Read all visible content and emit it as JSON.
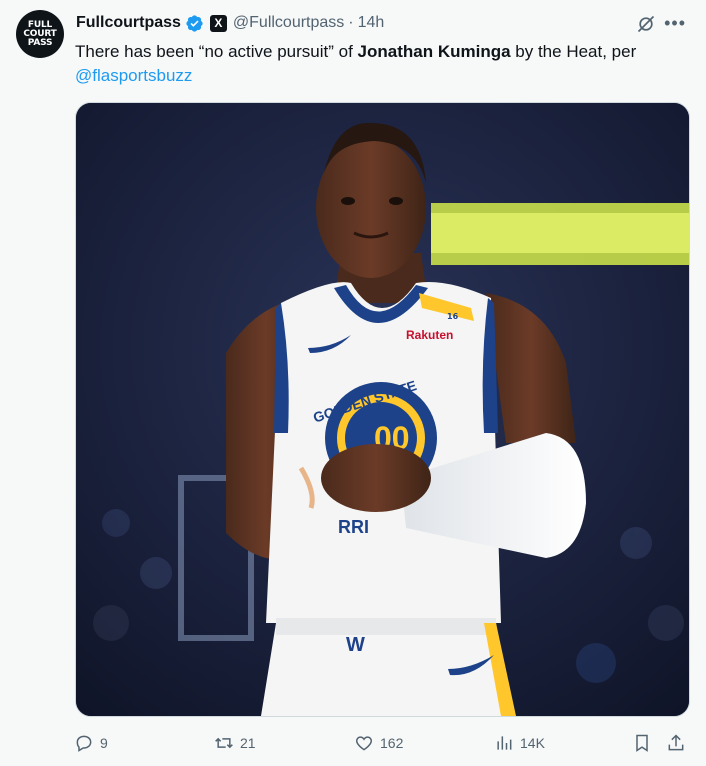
{
  "tweet": {
    "display_name": "Fullcourtpass",
    "handle": "@Fullcourtpass",
    "separator": "·",
    "time": "14h",
    "text_before": "There has been “no active pursuit” of ",
    "text_bold": "Jonathan Kuminga",
    "text_after": " by the Heat, per ",
    "mention": "@flasportsbuzz"
  },
  "avatar": {
    "line1": "FULL",
    "line2": "COURT",
    "line3": "PASS"
  },
  "affiliation_badge": "X",
  "media": {
    "jersey_team_text": "GOLDEN STATE",
    "jersey_number": "00",
    "sponsor_text": "Rakuten",
    "jersey_lower_text": "RRI",
    "shorts_logo": "W",
    "strap_number": "16"
  },
  "actions": {
    "replies": "9",
    "reposts": "21",
    "likes": "162",
    "views": "14K"
  },
  "colors": {
    "accent": "#1d9bf0",
    "muted": "#536471",
    "jersey_blue": "#1d428a",
    "jersey_gold": "#ffc72c"
  }
}
